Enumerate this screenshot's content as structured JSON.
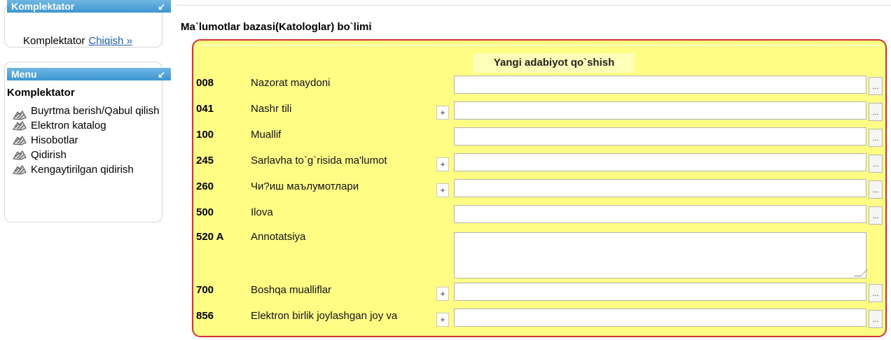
{
  "sidebar": {
    "top_panel": {
      "title": "Komplektator",
      "user": "Komplektator",
      "logout_link": "Chiqish »"
    },
    "menu_panel": {
      "title": "Menu",
      "section_title": "Komplektator",
      "items": [
        {
          "label": "Buyrtma berish/Qabul qilish",
          "icon": "books-icon"
        },
        {
          "label": "Elektron katalog",
          "icon": "books-icon"
        },
        {
          "label": "Hisobotlar",
          "icon": "books-icon"
        },
        {
          "label": "Qidirish",
          "icon": "books-icon"
        },
        {
          "label": "Kengaytirilgan qidirish",
          "icon": "books-icon"
        }
      ]
    }
  },
  "main": {
    "title": "Ma`lumotlar bazasi(Katologlar) bo`limi",
    "form": {
      "header": "Yangi adabiyot qo`shish",
      "add_label": "+",
      "browse_label": "...",
      "fields": [
        {
          "code": "008",
          "label": "Nazorat maydoni",
          "value": ""
        },
        {
          "code": "041",
          "label": "Nashr tili",
          "value": ""
        },
        {
          "code": "100",
          "label": "Muallif",
          "value": ""
        },
        {
          "code": "245",
          "label": "Sarlavha to`g`risida ma'lumot",
          "value": ""
        },
        {
          "code": "260",
          "label": "Чи?иш маълумотлари",
          "value": ""
        },
        {
          "code": "500",
          "label": "Ilova",
          "value": ""
        },
        {
          "code": "520 A",
          "label": "Annotatsiya",
          "value": ""
        },
        {
          "code": "700",
          "label": "Boshqa mualliflar",
          "value": ""
        },
        {
          "code": "856",
          "label": "Elektron birlik joylashgan joy va",
          "value": ""
        }
      ]
    }
  },
  "colors": {
    "panel_header": "#3c96d1",
    "form_background": "#fffd83",
    "form_border": "#d23232",
    "link": "#1a5fb4"
  }
}
